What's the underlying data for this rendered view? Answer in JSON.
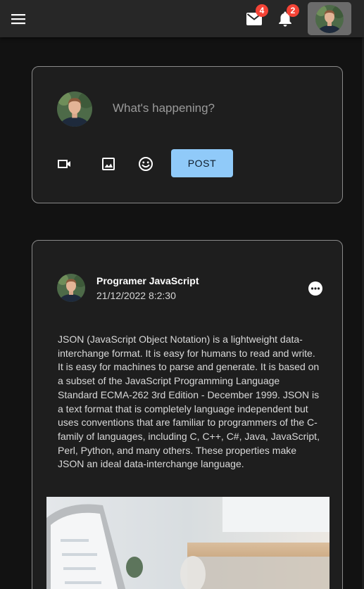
{
  "header": {
    "menu_icon": "hamburger-menu-icon",
    "mail": {
      "icon": "mail-icon",
      "badge": "4"
    },
    "notifications": {
      "icon": "bell-icon",
      "badge": "2"
    },
    "account_icon": "user-avatar"
  },
  "composer": {
    "placeholder": "What's happening?",
    "tools": [
      "video-icon",
      "image-icon",
      "emoji-icon"
    ],
    "post_label": "POST"
  },
  "post": {
    "author": "Programer JavaScript",
    "date": "21/12/2022 8:2:30",
    "body": "JSON (JavaScript Object Notation) is a lightweight data-interchange format. It is easy for humans to read and write. It is easy for machines to parse and generate. It is based on a subset of the JavaScript Programming Language Standard ECMA-262 3rd Edition - December 1999. JSON is a text format that is completely language independent but uses conventions that are familiar to programmers of the C-family of languages, including C, C++, C#, Java, JavaScript, Perl, Python, and many others. These properties make JSON an ideal data-interchange language.",
    "more_icon": "more-horizontal-icon"
  },
  "colors": {
    "background": "#121212",
    "appbar": "#272727",
    "card": "#1e1e1e",
    "badge": "#f44336",
    "primary_button": "#90caf9"
  }
}
